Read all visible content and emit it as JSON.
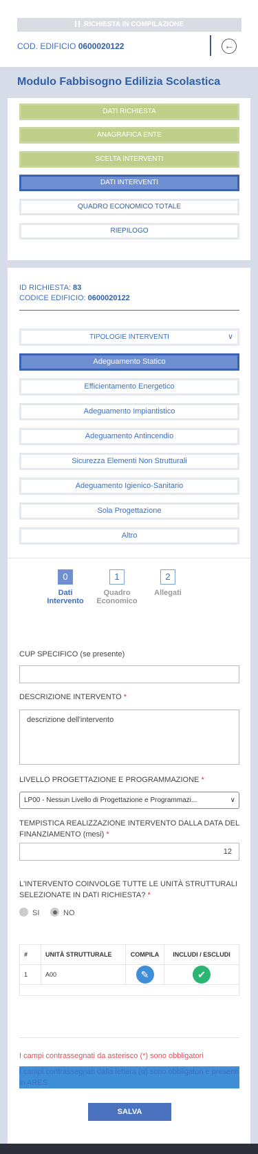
{
  "header": {
    "status_label": "RICHIESTA IN COMPILAZIONE",
    "cod_label": "COD. EDIFICIO",
    "cod_value": "0600020122",
    "back_icon": "arrow-left-circle-icon"
  },
  "module_title": "Modulo Fabbisogno Edilizia Scolastica",
  "steps": [
    {
      "label": "DATI RICHIESTA",
      "state": "done"
    },
    {
      "label": "ANAGRAFICA ENTE",
      "state": "done"
    },
    {
      "label": "SCELTA INTERVENTI",
      "state": "done"
    },
    {
      "label": "DATI INTERVENTI",
      "state": "active"
    },
    {
      "label": "QUADRO ECONOMICO TOTALE",
      "state": "pending"
    },
    {
      "label": "RIEPILOGO",
      "state": "pending"
    }
  ],
  "request": {
    "id_label": "ID RICHIESTA:",
    "id_value": "83",
    "code_label": "CODICE EDIFICIO:",
    "code_value": "0600020122"
  },
  "types_select": "TIPOLOGIE INTERVENTI",
  "interventions": [
    "Adeguamento Statico",
    "Efficientamento Energetico",
    "Adeguamento Impiantistico",
    "Adeguamento Antincendio",
    "Sicurezza Elementi Non Strutturali",
    "Adeguamento Igienico-Sanitario",
    "Sola Progettazione",
    "Altro"
  ],
  "tabs": [
    {
      "num": "0",
      "line1": "Dati",
      "line2": "Intervento"
    },
    {
      "num": "1",
      "line1": "Quadro",
      "line2": "Economico"
    },
    {
      "num": "2",
      "line1": "Allegati",
      "line2": ""
    }
  ],
  "form": {
    "cup_label": "CUP SPECIFICO (se presente)",
    "cup_value": "",
    "desc_label": "DESCRIZIONE INTERVENTO",
    "desc_value": "descrizione dell'intervento",
    "level_label": "LIVELLO PROGETTAZIONE E PROGRAMMAZIONE",
    "level_value": "LP00 - Nessun Livello di Progettazione e Programmazi...",
    "timing_label": "TEMPISTICA REALIZZAZIONE INTERVENTO DALLA DATA DEL FINANZIAMENTO (mesi)",
    "timing_value": "12",
    "units_label": "L'INTERVENTO COINVOLGE TUTTE LE UNITÀ STRUTTURALI SELEZIONATE IN DATI RICHIESTA?",
    "yes_label": "SI",
    "no_label": "NO",
    "required_mark": "*"
  },
  "table": {
    "headers": [
      "#",
      "UNITÀ STRUTTURALE",
      "COMPILA",
      "INCLUDI / ESCLUDI"
    ],
    "rows": [
      {
        "num": "1",
        "unit": "A00",
        "edit_icon": "pencil-icon",
        "include_icon": "check-icon"
      }
    ]
  },
  "notes": {
    "required": "I campi contrassegnati da asterisco (*) sono obbligatori",
    "ares": "I campi contrassegnati dalla lettera (α) sono obbligatori e presenti in ARES"
  },
  "save_label": "SALVA",
  "colors": {
    "primary": "#3d6fbf",
    "done": "#bfcf8a",
    "active": "#6e8fd1",
    "required": "#e04f5a"
  }
}
